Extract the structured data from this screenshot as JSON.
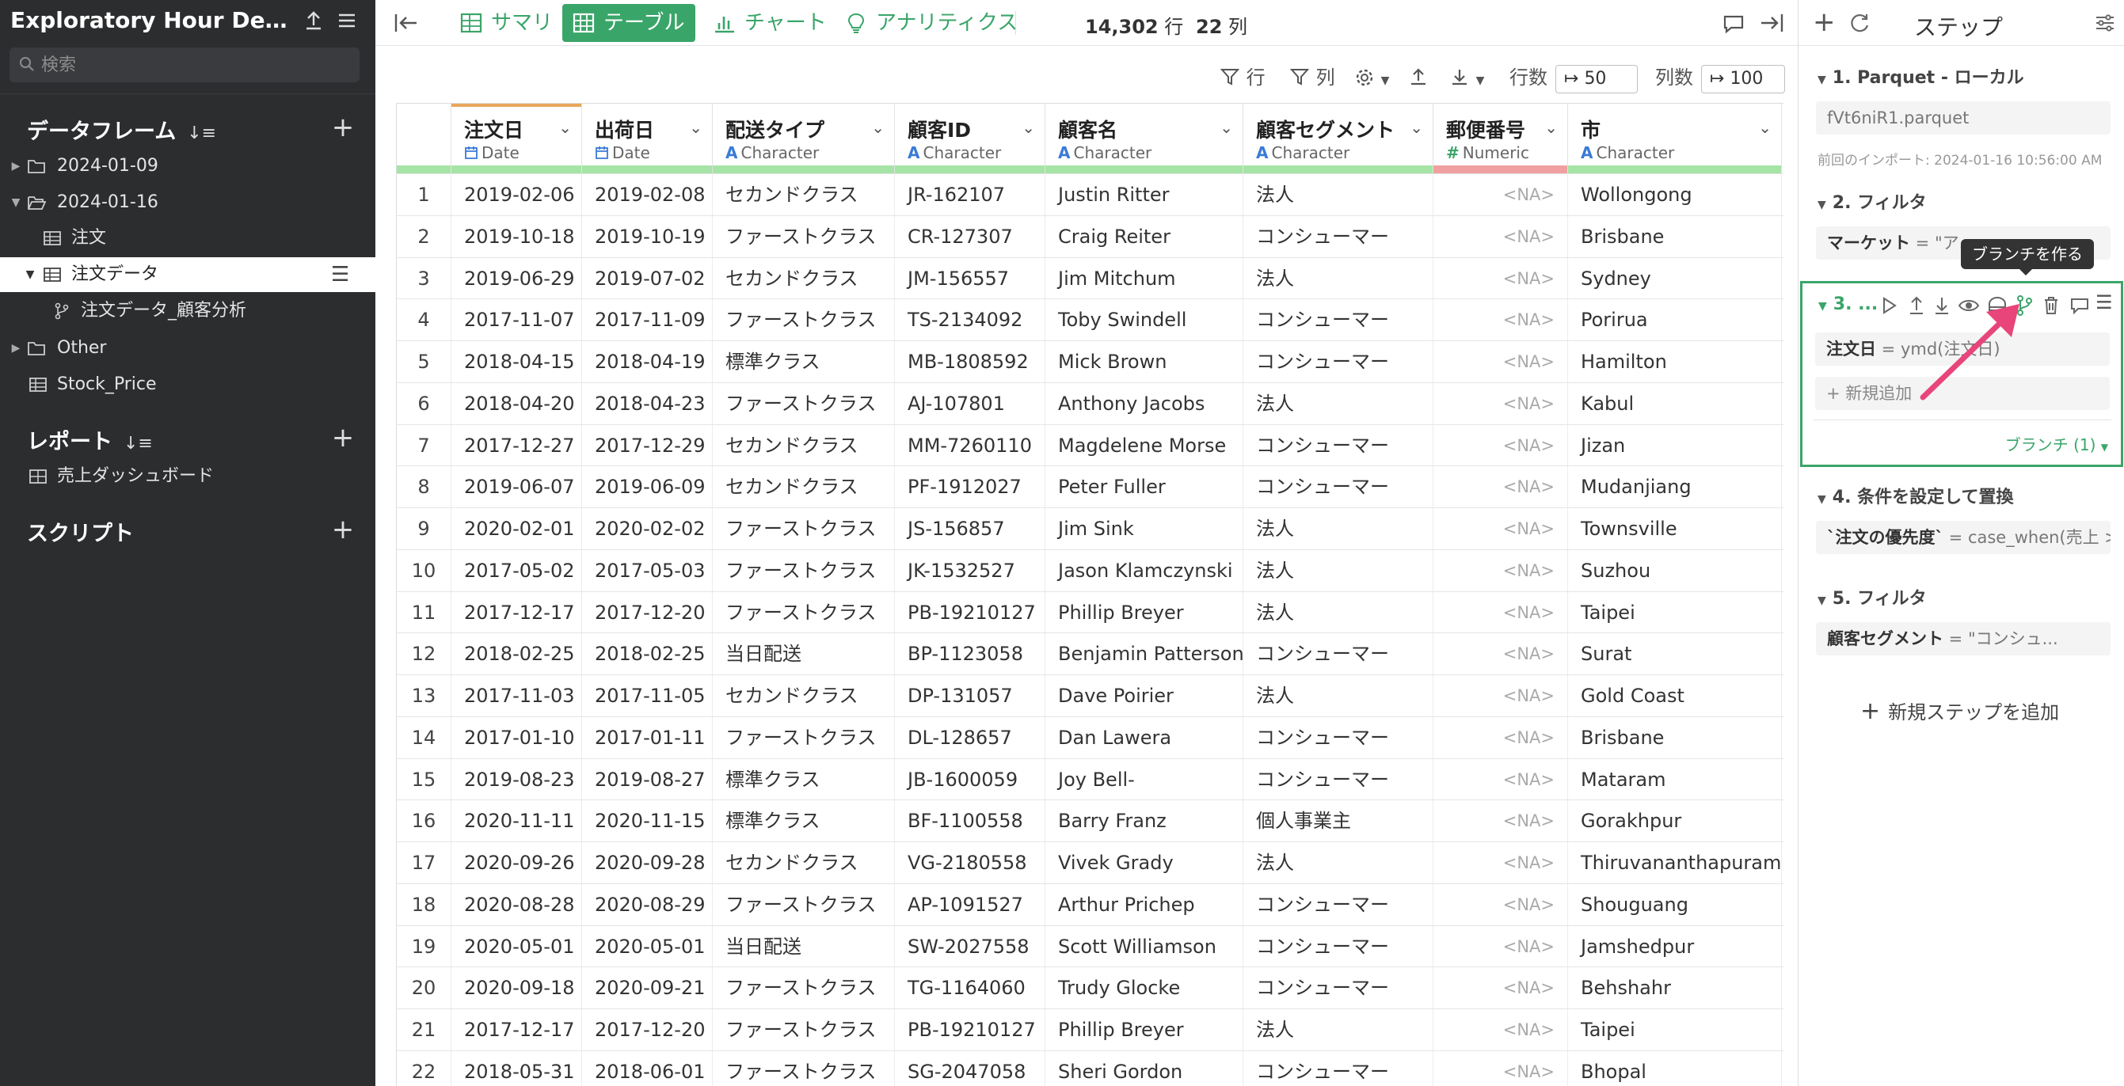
{
  "sidebar": {
    "title": "Exploratory Hour Demo ...",
    "search_placeholder": "検索",
    "dataframes_label": "データフレーム",
    "reports_label": "レポート",
    "scripts_label": "スクリプト",
    "items": [
      {
        "label": "2024-01-09",
        "kind": "folder"
      },
      {
        "label": "2024-01-16",
        "kind": "folder-open"
      },
      {
        "label": "注文",
        "kind": "table"
      },
      {
        "label": "注文データ",
        "kind": "table"
      },
      {
        "label": "注文データ_顧客分析",
        "kind": "branch"
      },
      {
        "label": "Other",
        "kind": "folder"
      },
      {
        "label": "Stock_Price",
        "kind": "table"
      }
    ],
    "reports": [
      {
        "label": "売上ダッシュボード"
      }
    ]
  },
  "toolbar": {
    "tabs": [
      "サマリ",
      "テーブル",
      "チャート",
      "アナリティクス"
    ],
    "active_tab": "テーブル",
    "row_count": "14,302",
    "row_unit": "行",
    "col_count": "22",
    "col_unit": "列"
  },
  "toolbar2": {
    "row_filter": "行",
    "col_filter": "列",
    "rows_label": "行数",
    "rows_value": "50",
    "cols_label": "列数",
    "cols_value": "100"
  },
  "table": {
    "columns": [
      {
        "name": "注文日",
        "type": "Date",
        "type_icon": "calendar-icon",
        "accent": "#e8a85c",
        "quality": "#a6e4a6"
      },
      {
        "name": "出荷日",
        "type": "Date",
        "type_icon": "calendar-icon",
        "accent": "",
        "quality": "#a6e4a6"
      },
      {
        "name": "配送タイプ",
        "type": "Character",
        "type_icon": "A",
        "accent": "",
        "quality": "#a6e4a6"
      },
      {
        "name": "顧客ID",
        "type": "Character",
        "type_icon": "A",
        "accent": "",
        "quality": "#a6e4a6"
      },
      {
        "name": "顧客名",
        "type": "Character",
        "type_icon": "A",
        "accent": "",
        "quality": "#a6e4a6"
      },
      {
        "name": "顧客セグメント",
        "type": "Character",
        "type_icon": "A",
        "accent": "",
        "quality": "#a6e4a6"
      },
      {
        "name": "郵便番号",
        "type": "Numeric",
        "type_icon": "#",
        "accent": "",
        "quality": "#f0a0a0"
      },
      {
        "name": "市",
        "type": "Character",
        "type_icon": "A",
        "accent": "",
        "quality": "#a6e4a6"
      }
    ],
    "rows": [
      [
        "1",
        "2019-02-06",
        "2019-02-08",
        "セカンドクラス",
        "JR-162107",
        "Justin Ritter",
        "法人",
        "<NA>",
        "Wollongong"
      ],
      [
        "2",
        "2019-10-18",
        "2019-10-19",
        "ファーストクラス",
        "CR-127307",
        "Craig Reiter",
        "コンシューマー",
        "<NA>",
        "Brisbane"
      ],
      [
        "3",
        "2019-06-29",
        "2019-07-02",
        "セカンドクラス",
        "JM-156557",
        "Jim Mitchum",
        "法人",
        "<NA>",
        "Sydney"
      ],
      [
        "4",
        "2017-11-07",
        "2017-11-09",
        "ファーストクラス",
        "TS-2134092",
        "Toby Swindell",
        "コンシューマー",
        "<NA>",
        "Porirua"
      ],
      [
        "5",
        "2018-04-15",
        "2018-04-19",
        "標準クラス",
        "MB-1808592",
        "Mick Brown",
        "コンシューマー",
        "<NA>",
        "Hamilton"
      ],
      [
        "6",
        "2018-04-20",
        "2018-04-23",
        "ファーストクラス",
        "AJ-107801",
        "Anthony Jacobs",
        "法人",
        "<NA>",
        "Kabul"
      ],
      [
        "7",
        "2017-12-27",
        "2017-12-29",
        "セカンドクラス",
        "MM-7260110",
        "Magdelene Morse",
        "コンシューマー",
        "<NA>",
        "Jizan"
      ],
      [
        "8",
        "2019-06-07",
        "2019-06-09",
        "セカンドクラス",
        "PF-1912027",
        "Peter Fuller",
        "コンシューマー",
        "<NA>",
        "Mudanjiang"
      ],
      [
        "9",
        "2020-02-01",
        "2020-02-02",
        "ファーストクラス",
        "JS-156857",
        "Jim Sink",
        "法人",
        "<NA>",
        "Townsville"
      ],
      [
        "10",
        "2017-05-02",
        "2017-05-03",
        "ファーストクラス",
        "JK-1532527",
        "Jason Klamczynski",
        "法人",
        "<NA>",
        "Suzhou"
      ],
      [
        "11",
        "2017-12-17",
        "2017-12-20",
        "ファーストクラス",
        "PB-19210127",
        "Phillip Breyer",
        "法人",
        "<NA>",
        "Taipei"
      ],
      [
        "12",
        "2018-02-25",
        "2018-02-25",
        "当日配送",
        "BP-1123058",
        "Benjamin Patterson",
        "コンシューマー",
        "<NA>",
        "Surat"
      ],
      [
        "13",
        "2017-11-03",
        "2017-11-05",
        "セカンドクラス",
        "DP-131057",
        "Dave Poirier",
        "法人",
        "<NA>",
        "Gold Coast"
      ],
      [
        "14",
        "2017-01-10",
        "2017-01-11",
        "ファーストクラス",
        "DL-128657",
        "Dan Lawera",
        "コンシューマー",
        "<NA>",
        "Brisbane"
      ],
      [
        "15",
        "2019-08-23",
        "2019-08-27",
        "標準クラス",
        "JB-1600059",
        "Joy Bell-",
        "コンシューマー",
        "<NA>",
        "Mataram"
      ],
      [
        "16",
        "2020-11-11",
        "2020-11-15",
        "標準クラス",
        "BF-1100558",
        "Barry Franz",
        "個人事業主",
        "<NA>",
        "Gorakhpur"
      ],
      [
        "17",
        "2020-09-26",
        "2020-09-28",
        "セカンドクラス",
        "VG-2180558",
        "Vivek Grady",
        "法人",
        "<NA>",
        "Thiruvananthapuram"
      ],
      [
        "18",
        "2020-08-28",
        "2020-08-29",
        "ファーストクラス",
        "AP-1091527",
        "Arthur Prichep",
        "コンシューマー",
        "<NA>",
        "Shouguang"
      ],
      [
        "19",
        "2020-05-01",
        "2020-05-01",
        "当日配送",
        "SW-2027558",
        "Scott Williamson",
        "コンシューマー",
        "<NA>",
        "Jamshedpur"
      ],
      [
        "20",
        "2020-09-18",
        "2020-09-21",
        "ファーストクラス",
        "TG-1164060",
        "Trudy Glocke",
        "コンシューマー",
        "<NA>",
        "Behshahr"
      ],
      [
        "21",
        "2017-12-17",
        "2017-12-20",
        "ファーストクラス",
        "PB-19210127",
        "Phillip Breyer",
        "法人",
        "<NA>",
        "Taipei"
      ],
      [
        "22",
        "2018-05-31",
        "2018-06-01",
        "ファーストクラス",
        "SG-2047058",
        "Sheri Gordon",
        "コンシューマー",
        "<NA>",
        "Bhopal"
      ]
    ]
  },
  "steps_panel": {
    "title": "ステップ",
    "steps": [
      {
        "title": "1. Parquet - ローカル",
        "box": "fVt6niR1.parquet",
        "note": "前回のインポート: 2024-01-16 10:56:00 AM"
      },
      {
        "title": "2. フィルタ",
        "box_key": "マーケット",
        "box_rest": " = \"ア..."
      },
      {
        "title": "3. ...",
        "box_key": "注文日",
        "box_rest": " = ymd(注文日)",
        "add_label": "新規追加",
        "branch_label": "ブランチ (1)"
      },
      {
        "title": "4. 条件を設定して置換",
        "box_key": "`注文の優先度`",
        "box_rest": " = case_when(売上 >..."
      },
      {
        "title": "5. フィルタ",
        "box_key": "顧客セグメント",
        "box_rest": " = \"コンシュ..."
      }
    ],
    "add_step_label": "新規ステップを追加",
    "tooltip": "ブランチを作る"
  },
  "colors": {
    "accent_green": "#3aa569",
    "sidebar_bg": "#2c2d2f",
    "arrow_pink": "#e8457a"
  }
}
